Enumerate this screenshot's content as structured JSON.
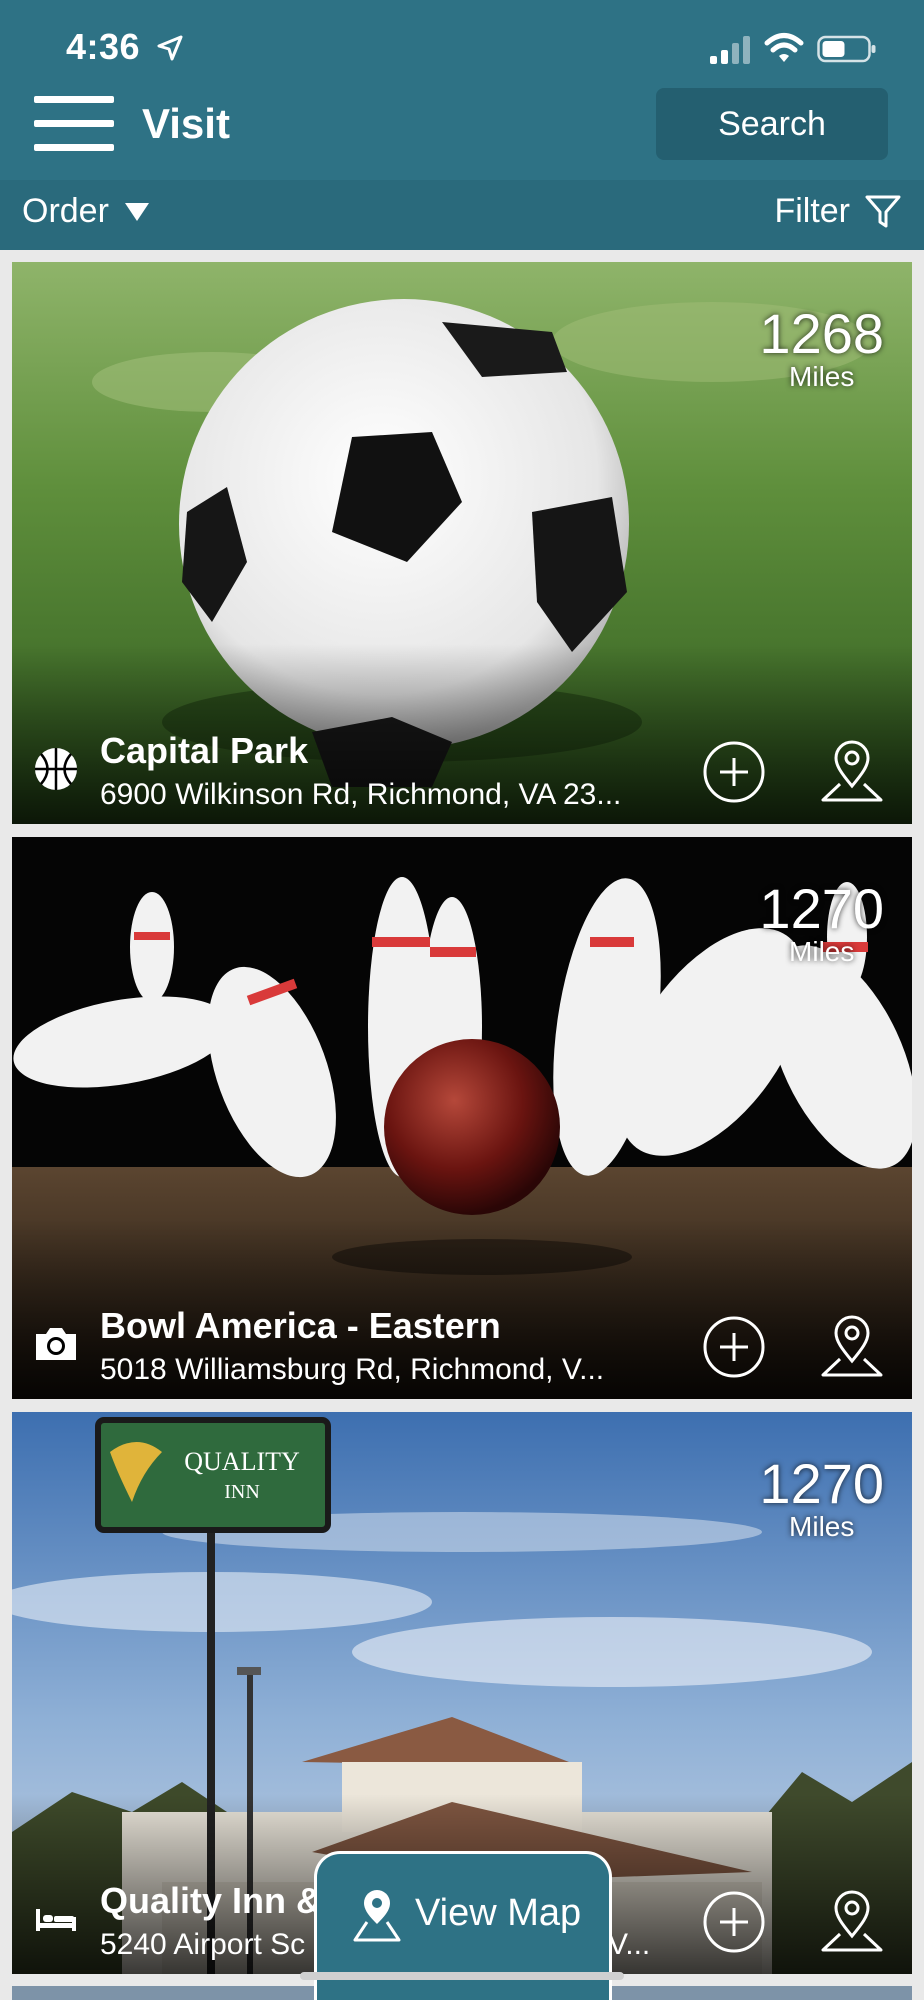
{
  "status_bar": {
    "time": "4:36",
    "icons": [
      "location-arrow-icon",
      "signal-icon",
      "wifi-icon",
      "battery-icon"
    ]
  },
  "header": {
    "title": "Visit",
    "search_label": "Search"
  },
  "toolbar": {
    "order_label": "Order",
    "filter_label": "Filter"
  },
  "listings": [
    {
      "title": "Capital Park",
      "address": "6900 Wilkinson Rd, Richmond, VA 23...",
      "distance": "1268",
      "distance_unit": "Miles",
      "category_icon": "basketball-icon"
    },
    {
      "title": "Bowl America - Eastern",
      "address": "5018 Williamsburg Rd, Richmond, V...",
      "distance": "1270",
      "distance_unit": "Miles",
      "category_icon": "camera-icon"
    },
    {
      "title": "Quality Inn &",
      "address": "5240 Airport Sc",
      "address_tail": "V...",
      "distance": "1270",
      "distance_unit": "Miles",
      "category_icon": "bed-icon",
      "sign_text": [
        "QUALITY",
        "INN"
      ]
    }
  ],
  "view_map": {
    "label": "View Map"
  },
  "colors": {
    "header": "#2e7285",
    "subheader": "#2a6a7c",
    "search_button": "#245f70"
  }
}
